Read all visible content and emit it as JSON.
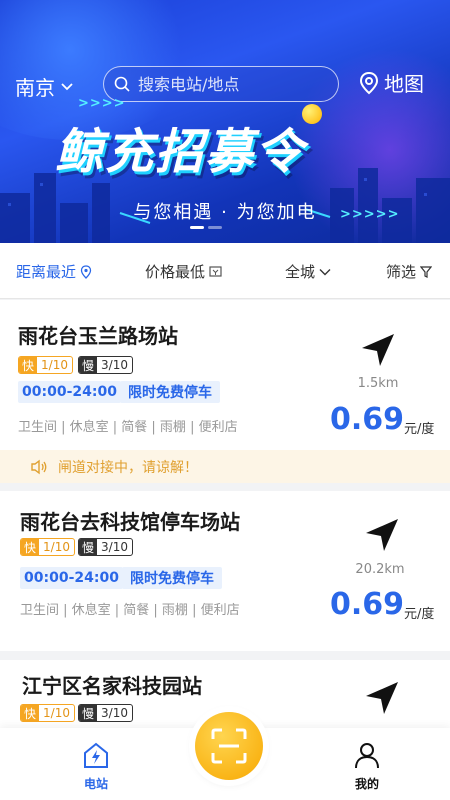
{
  "header": {
    "city": "南京",
    "search_placeholder": "搜索电站/地点",
    "map_label": "地图"
  },
  "banner": {
    "title": "鲸充招募令",
    "subtitle": "与您相遇 · 为您加电",
    "arrows": ">>>>",
    "arrows2": ">>>>>"
  },
  "filters": {
    "distance": "距离最近",
    "price": "价格最低",
    "area": "全城",
    "filter": "筛选"
  },
  "notice": "闸道对接中，请谅解！",
  "stations": [
    {
      "name": "雨花台玉兰路场站",
      "fast_key": "快",
      "fast_val": "1/10",
      "slow_key": "慢",
      "slow_val": "3/10",
      "hours": "00:00-24:00",
      "parking": "限时免费停车",
      "amenities": "卫生间 | 休息室 | 简餐 | 雨棚 | 便利店",
      "distance": "1.5km",
      "price": "0.69",
      "unit": "元/度"
    },
    {
      "name": "雨花台去科技馆停车场站",
      "fast_key": "快",
      "fast_val": "1/10",
      "slow_key": "慢",
      "slow_val": "3/10",
      "hours": "00:00-24:00",
      "parking": "限时免费停车",
      "amenities": "卫生间 | 休息室 | 简餐 | 雨棚 | 便利店",
      "distance": "20.2km",
      "price": "0.69",
      "unit": "元/度"
    },
    {
      "name": "江宁区名家科技园站",
      "fast_key": "快",
      "fast_val": "1/10",
      "slow_key": "慢",
      "slow_val": "3/10"
    }
  ],
  "tabbar": {
    "station": "电站",
    "mine": "我的"
  },
  "colors": {
    "accent": "#2a67e8",
    "fast": "#f5a623",
    "scan": "#f7a700"
  }
}
